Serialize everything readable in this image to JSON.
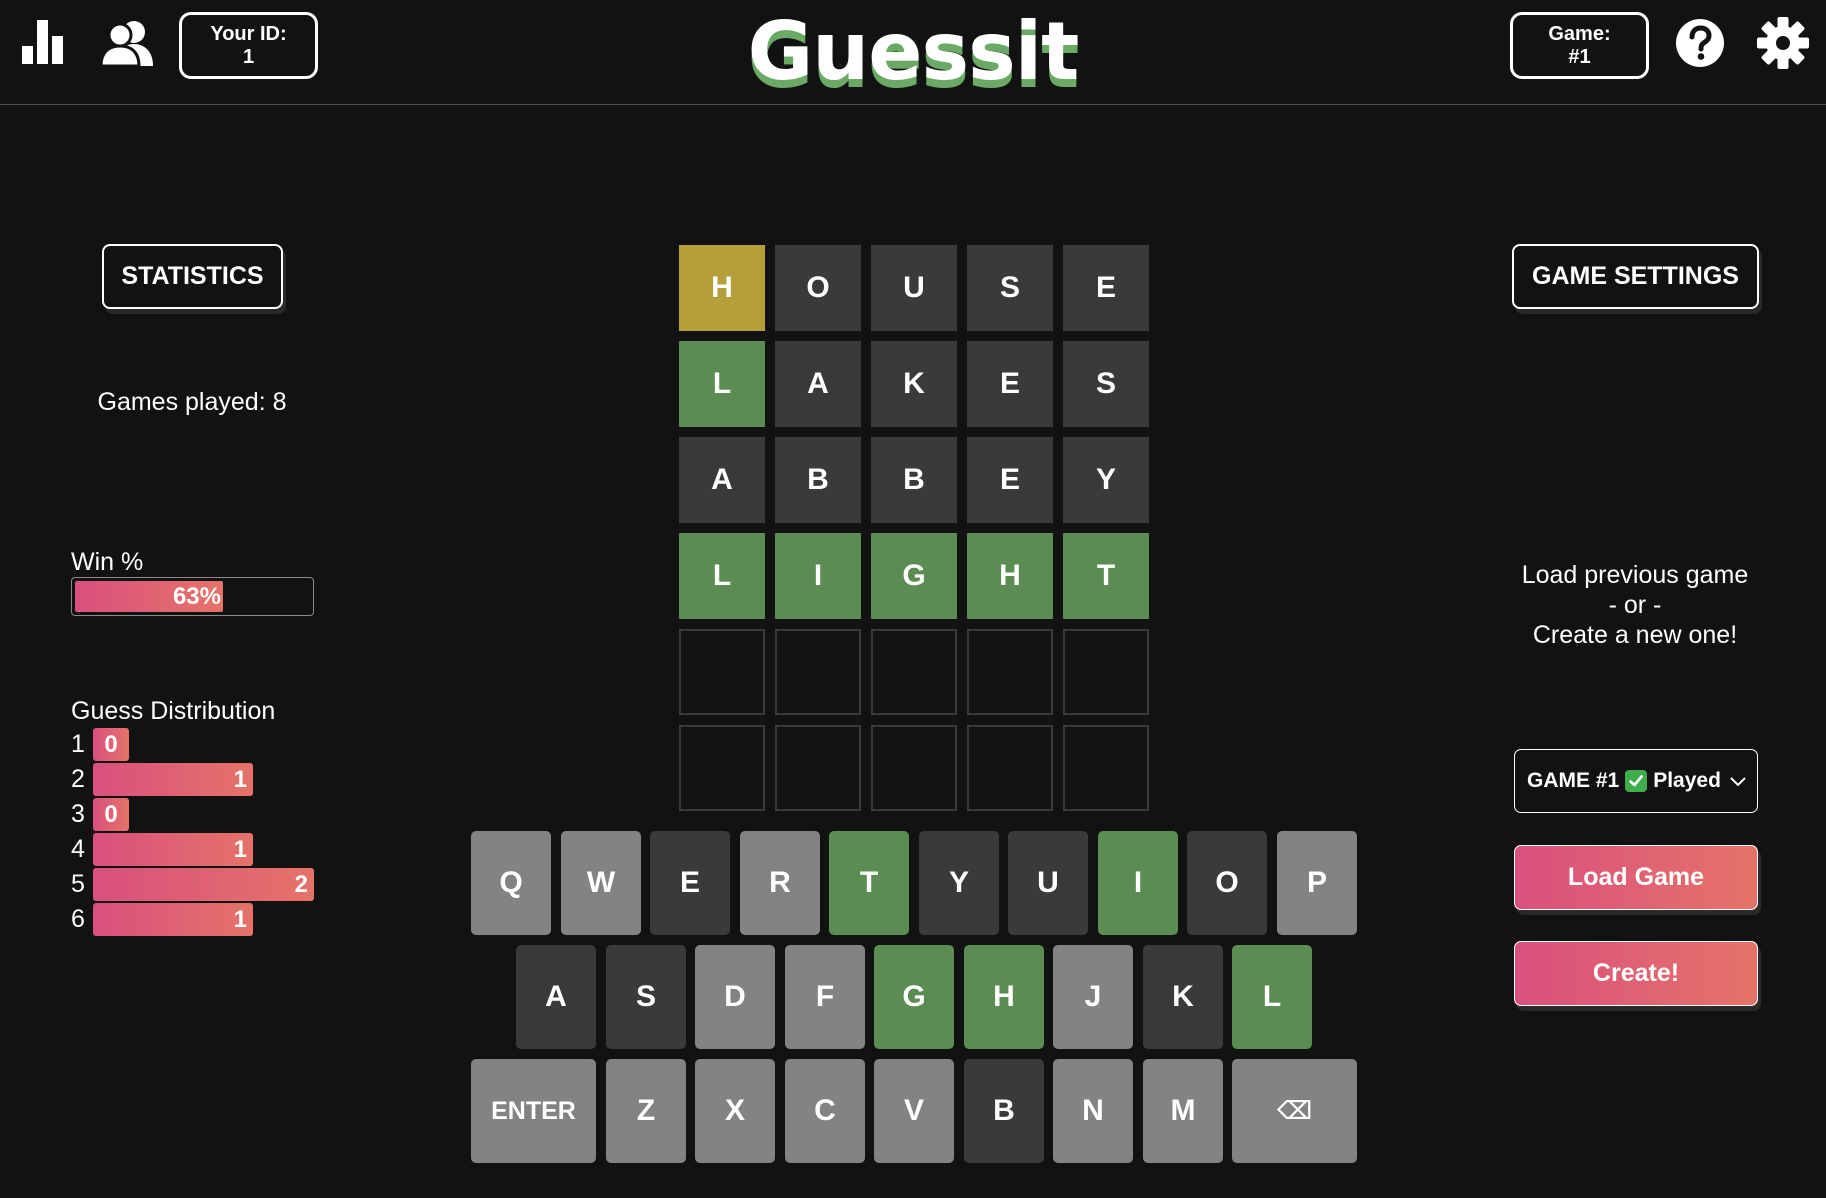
{
  "header": {
    "title": "Guessit",
    "your_id_label": "Your ID:",
    "your_id_value": "1",
    "game_label": "Game:",
    "game_value": "#1",
    "icons": [
      "bar-chart-icon",
      "friends-icon",
      "help-icon",
      "gear-icon"
    ]
  },
  "stats": {
    "button_label": "STATISTICS",
    "games_played": "Games played: 8",
    "win_label": "Win %",
    "win_percent": 63,
    "win_text": "63%",
    "dist_title": "Guess Distribution",
    "distribution": [
      {
        "guess": "1",
        "count": 0
      },
      {
        "guess": "2",
        "count": 1
      },
      {
        "guess": "3",
        "count": 0
      },
      {
        "guess": "4",
        "count": 1
      },
      {
        "guess": "5",
        "count": 2
      },
      {
        "guess": "6",
        "count": 1
      }
    ]
  },
  "board": {
    "rows": [
      [
        {
          "l": "H",
          "s": "present"
        },
        {
          "l": "O",
          "s": "absent"
        },
        {
          "l": "U",
          "s": "absent"
        },
        {
          "l": "S",
          "s": "absent"
        },
        {
          "l": "E",
          "s": "absent"
        }
      ],
      [
        {
          "l": "L",
          "s": "correct"
        },
        {
          "l": "A",
          "s": "absent"
        },
        {
          "l": "K",
          "s": "absent"
        },
        {
          "l": "E",
          "s": "absent"
        },
        {
          "l": "S",
          "s": "absent"
        }
      ],
      [
        {
          "l": "A",
          "s": "absent"
        },
        {
          "l": "B",
          "s": "absent"
        },
        {
          "l": "B",
          "s": "absent"
        },
        {
          "l": "E",
          "s": "absent"
        },
        {
          "l": "Y",
          "s": "absent"
        }
      ],
      [
        {
          "l": "L",
          "s": "correct"
        },
        {
          "l": "I",
          "s": "correct"
        },
        {
          "l": "G",
          "s": "correct"
        },
        {
          "l": "H",
          "s": "correct"
        },
        {
          "l": "T",
          "s": "correct"
        }
      ],
      [
        {
          "l": "",
          "s": "empty"
        },
        {
          "l": "",
          "s": "empty"
        },
        {
          "l": "",
          "s": "empty"
        },
        {
          "l": "",
          "s": "empty"
        },
        {
          "l": "",
          "s": "empty"
        }
      ],
      [
        {
          "l": "",
          "s": "empty"
        },
        {
          "l": "",
          "s": "empty"
        },
        {
          "l": "",
          "s": "empty"
        },
        {
          "l": "",
          "s": "empty"
        },
        {
          "l": "",
          "s": "empty"
        }
      ]
    ]
  },
  "keyboard": {
    "rows": [
      [
        {
          "k": "Q",
          "s": "unused"
        },
        {
          "k": "W",
          "s": "unused"
        },
        {
          "k": "E",
          "s": "absent"
        },
        {
          "k": "R",
          "s": "unused"
        },
        {
          "k": "T",
          "s": "correct"
        },
        {
          "k": "Y",
          "s": "absent"
        },
        {
          "k": "U",
          "s": "absent"
        },
        {
          "k": "I",
          "s": "correct"
        },
        {
          "k": "O",
          "s": "absent"
        },
        {
          "k": "P",
          "s": "unused"
        }
      ],
      [
        {
          "k": "A",
          "s": "absent"
        },
        {
          "k": "S",
          "s": "absent"
        },
        {
          "k": "D",
          "s": "unused"
        },
        {
          "k": "F",
          "s": "unused"
        },
        {
          "k": "G",
          "s": "correct"
        },
        {
          "k": "H",
          "s": "correct"
        },
        {
          "k": "J",
          "s": "unused"
        },
        {
          "k": "K",
          "s": "absent"
        },
        {
          "k": "L",
          "s": "correct"
        }
      ],
      [
        {
          "k": "ENTER",
          "s": "unused",
          "wide": true
        },
        {
          "k": "Z",
          "s": "unused"
        },
        {
          "k": "X",
          "s": "unused"
        },
        {
          "k": "C",
          "s": "unused"
        },
        {
          "k": "V",
          "s": "unused"
        },
        {
          "k": "B",
          "s": "absent"
        },
        {
          "k": "N",
          "s": "unused"
        },
        {
          "k": "M",
          "s": "unused"
        },
        {
          "k": "⌫",
          "s": "unused",
          "wide": true,
          "icon": "backspace-icon"
        }
      ]
    ]
  },
  "right": {
    "settings_label": "GAME SETTINGS",
    "load_line1": "Load previous game",
    "load_line2": "- or -",
    "load_line3": "Create a new one!",
    "select_prefix": "GAME #1",
    "select_status": "Played",
    "load_button": "Load Game",
    "create_button": "Create!"
  },
  "colors": {
    "background": "#121212",
    "correct": "#5b8c51",
    "present": "#b59f3b",
    "absent": "#3a3a3c",
    "unused_key": "#818384",
    "accent_gradient_start": "#d9507e",
    "accent_gradient_end": "#e57368"
  }
}
